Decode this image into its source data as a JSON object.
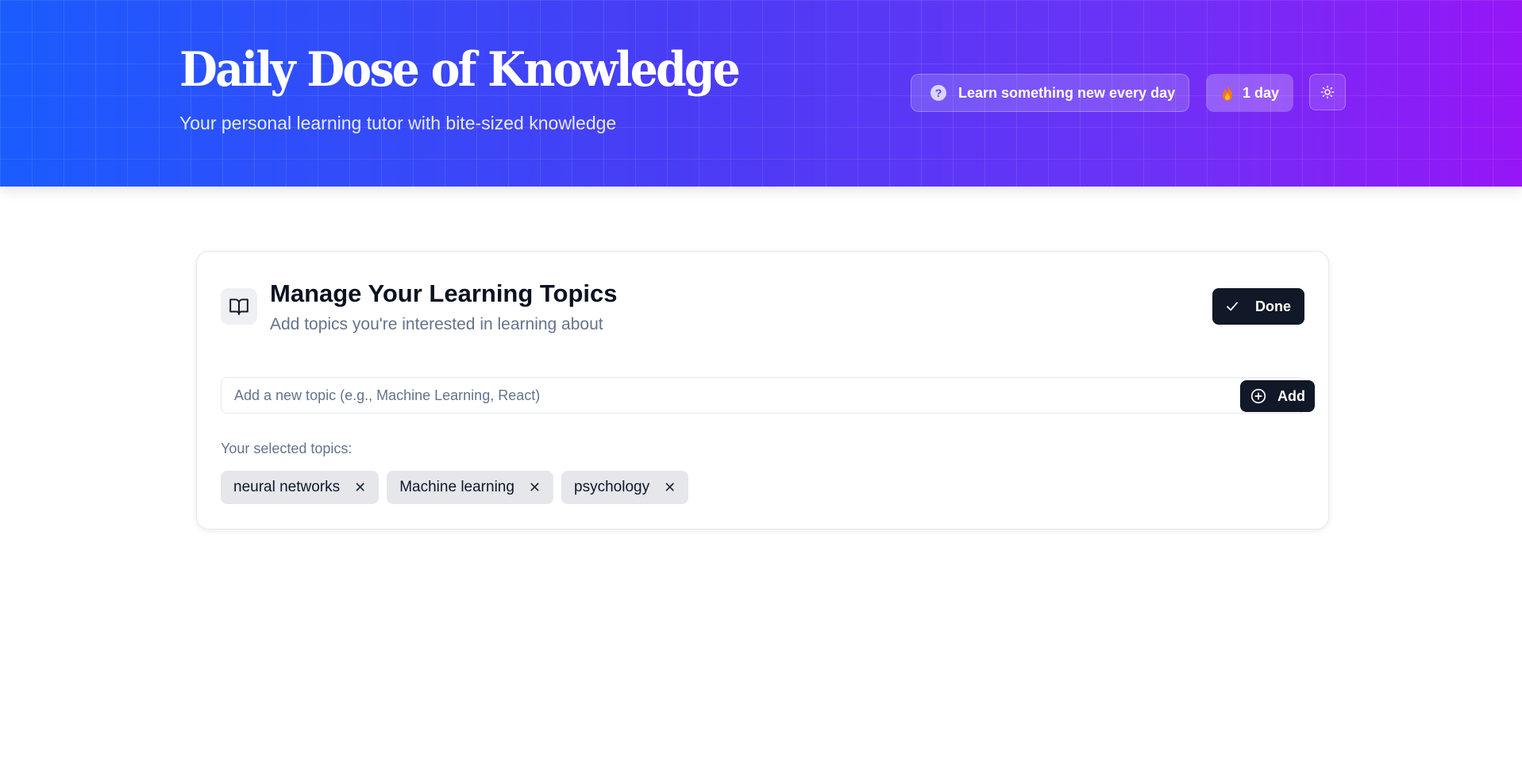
{
  "header": {
    "title": "Daily Dose of Knowledge",
    "subtitle": "Your personal learning tutor with bite-sized knowledge",
    "tagline": "Learn something new every day",
    "streak": "1 day",
    "gradient_start": "#1a5cff",
    "gradient_end": "#9616f7",
    "icons": [
      "help-circle-icon",
      "flame-icon",
      "sun-icon"
    ]
  },
  "topics_card": {
    "title": "Manage Your Learning Topics",
    "subtitle": "Add topics you're interested in learning about",
    "done_label": "Done",
    "input": {
      "value": "",
      "placeholder": "Add a new topic (e.g., Machine Learning, React)"
    },
    "add_label": "Add",
    "selected_label": "Your selected topics:",
    "topics": [
      "neural networks",
      "Machine learning",
      "psychology"
    ],
    "remove_glyph": "✕",
    "icons": [
      "book-open-icon",
      "check-icon",
      "plus-circle-icon",
      "close-icon"
    ]
  },
  "colors": {
    "primary_button": "#111827",
    "chip_background": "#e5e7eb",
    "muted_text": "#64748b"
  }
}
